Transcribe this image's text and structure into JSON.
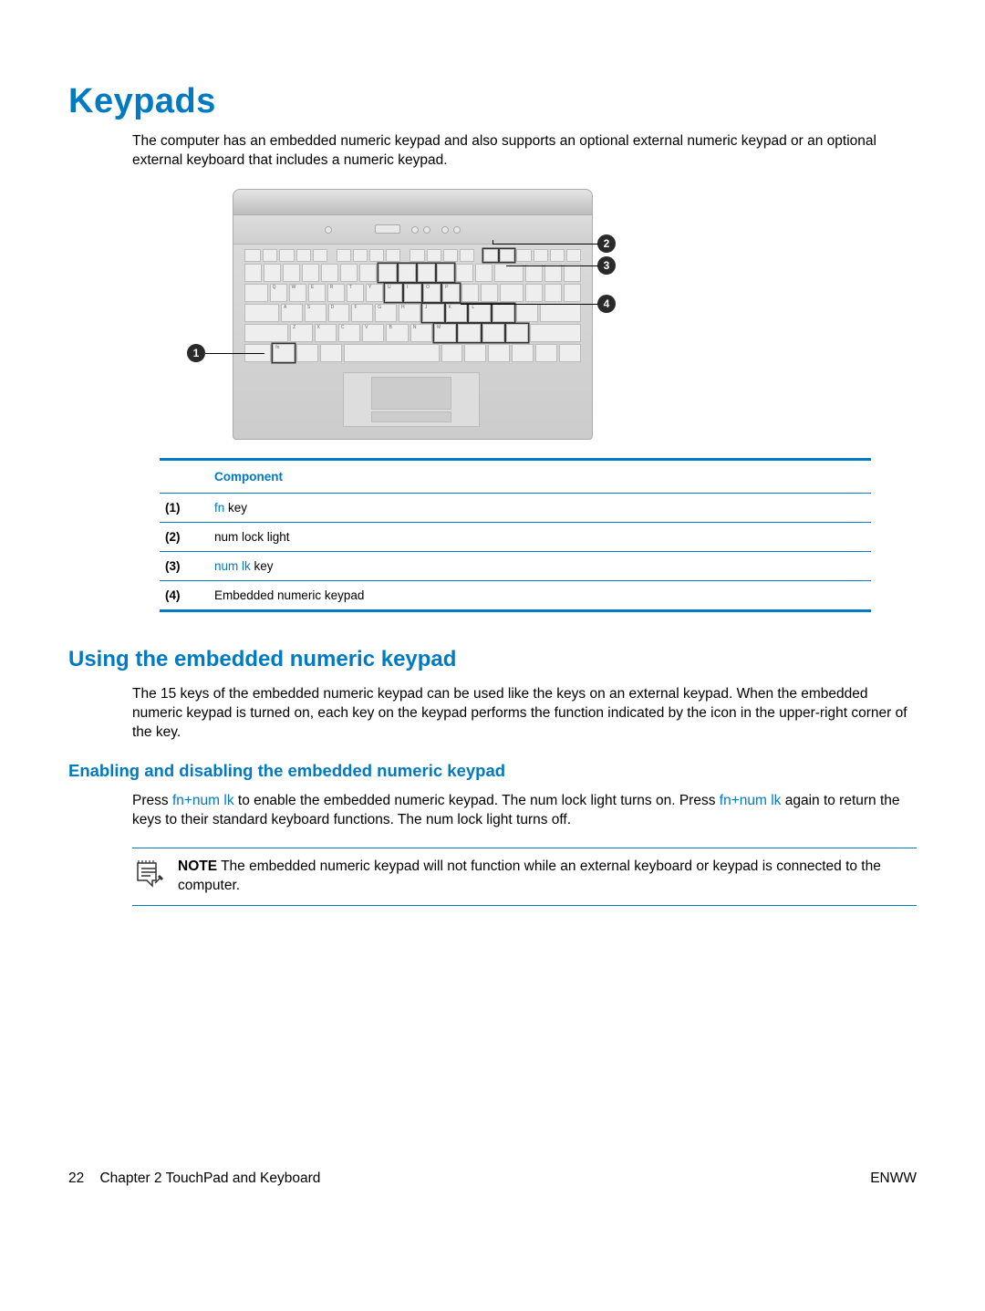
{
  "heading_main": "Keypads",
  "intro_text": "The computer has an embedded numeric keypad and also supports an optional external numeric keypad or an optional external keyboard that includes a numeric keypad.",
  "callouts": {
    "c1": "1",
    "c2": "2",
    "c3": "3",
    "c4": "4"
  },
  "table": {
    "header_component": "Component",
    "rows": [
      {
        "num": "(1)",
        "desc_kw": "fn",
        "desc_suffix": " key"
      },
      {
        "num": "(2)",
        "desc_plain": "num lock light"
      },
      {
        "num": "(3)",
        "desc_kw": "num lk",
        "desc_suffix": " key"
      },
      {
        "num": "(4)",
        "desc_plain": "Embedded numeric keypad"
      }
    ]
  },
  "heading_sub1": "Using the embedded numeric keypad",
  "sub1_text": "The 15 keys of the embedded numeric keypad can be used like the keys on an external keypad. When the embedded numeric keypad is turned on, each key on the keypad performs the function indicated by the icon in the upper-right corner of the key.",
  "heading_sub2": "Enabling and disabling the embedded numeric keypad",
  "sub2_prefix": "Press ",
  "sub2_kw1": "fn+num lk",
  "sub2_mid": " to enable the embedded numeric keypad. The num lock light turns on. Press ",
  "sub2_kw2": "fn+num lk",
  "sub2_suffix": " again to return the keys to their standard keyboard functions. The num lock light turns off.",
  "note_label": "NOTE",
  "note_text": "   The embedded numeric keypad will not function while an external keyboard or keypad is connected to the computer.",
  "footer": {
    "page_number": "22",
    "chapter": "Chapter 2   TouchPad and Keyboard",
    "right": "ENWW"
  }
}
